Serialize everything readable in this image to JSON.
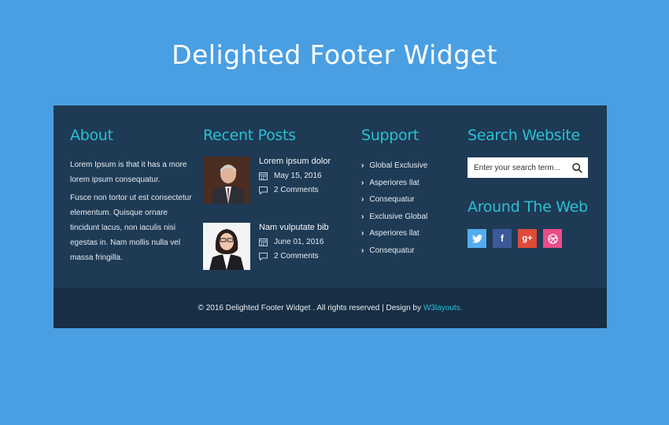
{
  "page": {
    "title": "Delighted Footer Widget"
  },
  "about": {
    "heading": "About",
    "paragraph1": "Lorem Ipsum is that it has a more lorem ipsum consequatur.",
    "paragraph2": "Fusce non tortor ut est consectetur elementum. Quisque ornare tincidunt lacus, non iaculis nisi egestas in. Nam mollis nulla vel massa fringilla."
  },
  "recent_posts": {
    "heading": "Recent Posts",
    "posts": [
      {
        "title": "Lorem ipsum dolor",
        "date": "May 15, 2016",
        "comments": "2 Comments"
      },
      {
        "title": "Nam vulputate bib",
        "date": "June 01, 2016",
        "comments": "2 Comments"
      }
    ]
  },
  "support": {
    "heading": "Support",
    "items": [
      "Global Exclusive",
      "Asperiores llat",
      "Consequatur",
      "Exclusive Global",
      "Asperiores llat",
      "Consequatur"
    ]
  },
  "search": {
    "heading": "Search Website",
    "placeholder": "Enter your search term..."
  },
  "web": {
    "heading": "Around The Web",
    "social": [
      {
        "name": "twitter-icon",
        "glyph": "",
        "color": "#55acee"
      },
      {
        "name": "facebook-icon",
        "glyph": "f",
        "color": "#3b5998"
      },
      {
        "name": "google-plus-icon",
        "glyph": "g+",
        "color": "#dd4b39"
      },
      {
        "name": "dribbble-icon",
        "glyph": "",
        "color": "#ea4c89"
      }
    ]
  },
  "copyright": {
    "text": "© 2016 Delighted Footer Widget . All rights reserved | Design by",
    "link": "W3layouts."
  },
  "colors": {
    "background": "#4a9fe2",
    "footer": "#1e3a55",
    "footer_bottom": "#172e44",
    "accent": "#29c1d3"
  }
}
